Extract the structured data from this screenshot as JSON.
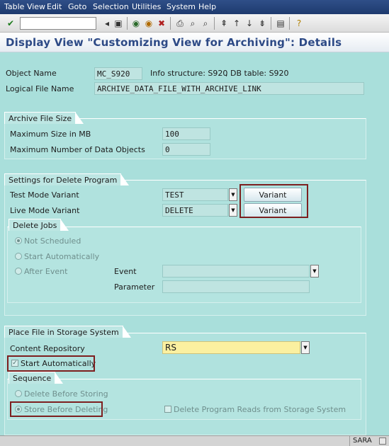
{
  "menu": [
    "Table View",
    "Edit",
    "Goto",
    "Selection",
    "Utilities",
    "System",
    "Help"
  ],
  "title": "Display View \"Customizing View for Archiving\": Details",
  "header": {
    "object_name_label": "Object Name",
    "object_name_value": "MC_S920",
    "info_structure": "Info structure: S920",
    "db_table": ", DB table: S920",
    "logical_file_label": "Logical File Name",
    "logical_file_value": "ARCHIVE_DATA_FILE_WITH_ARCHIVE_LINK"
  },
  "archive_file_size": {
    "title": "Archive File Size",
    "max_size_label": "Maximum Size in MB",
    "max_size_value": "100",
    "max_objects_label": "Maximum Number of Data Objects",
    "max_objects_value": "0"
  },
  "delete_program": {
    "title": "Settings for Delete Program",
    "test_mode_label": "Test Mode Variant",
    "test_mode_value": "TEST",
    "live_mode_label": "Live Mode Variant",
    "live_mode_value": "DELETE",
    "variant_button": "Variant",
    "delete_jobs": {
      "title": "Delete Jobs",
      "not_scheduled": "Not Scheduled",
      "start_automatically": "Start Automatically",
      "after_event": "After Event",
      "event_label": "Event",
      "parameter_label": "Parameter"
    }
  },
  "storage": {
    "title": "Place File in Storage System",
    "content_repo_label": "Content Repository",
    "content_repo_value": "RS",
    "start_automatically": "Start Automatically",
    "sequence": {
      "title": "Sequence",
      "delete_before_storing": "Delete Before Storing",
      "store_before_deleting": "Store Before Deleting",
      "delete_program_reads": "Delete Program Reads from Storage System"
    }
  },
  "status": {
    "system": "SARA"
  },
  "colors": {
    "highlight": "#7d1f1f",
    "background": "#a9dfdb",
    "title": "#2d4a86"
  }
}
